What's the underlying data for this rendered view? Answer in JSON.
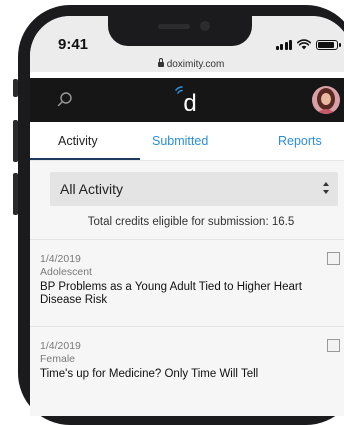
{
  "status_bar": {
    "time": "9:41"
  },
  "browser": {
    "url": "doximity.com"
  },
  "app_bar": {
    "logo_letter": "d",
    "accent_color": "#2b8ed8"
  },
  "tabs": [
    {
      "label": "Activity",
      "active": true
    },
    {
      "label": "Submitted",
      "active": false
    },
    {
      "label": "Reports",
      "active": false
    }
  ],
  "filter": {
    "selected": "All Activity"
  },
  "credits_summary": "Total credits eligible for submission: 16.5",
  "items": [
    {
      "date": "1/4/2019",
      "category": "Adolescent",
      "title": "BP Problems as a Young Adult Tied to Higher Heart Disease Risk",
      "checked": false
    },
    {
      "date": "1/4/2019",
      "category": "Female",
      "title": "Time's up for Medicine? Only Time Will Tell",
      "checked": false
    }
  ]
}
